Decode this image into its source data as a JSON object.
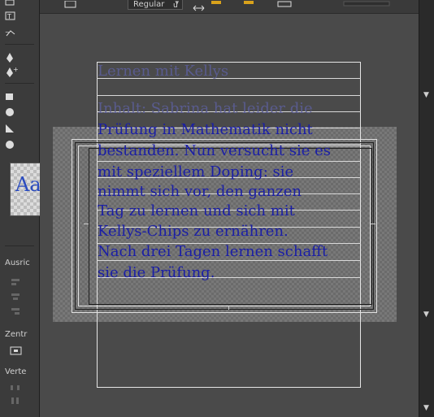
{
  "toolbar": {
    "font_style": "Regular"
  },
  "panel": {
    "preview_text": "Aa",
    "labels": {
      "ausrichten": "Ausric",
      "zentrieren": "Zentr",
      "verteilen": "Verte"
    }
  },
  "text": {
    "title": "Lernen mit Kellys",
    "lines": [
      "Inhalt: Sabrina hat leider die",
      "Prüfung in Mathematik nicht",
      "bestanden. Nun versucht sie es",
      "mit speziellem Doping: sie",
      "nimmt sich vor, den ganzen",
      "Tag zu lernen und sich mit",
      "Kellys-Chips zu ernähren.",
      "Nach drei Tagen lernen schafft",
      "sie die Prüfung."
    ]
  },
  "colors": {
    "text": "#1a1ea6",
    "workarea": "#4a4a4a",
    "panel": "#3b3b3b"
  }
}
